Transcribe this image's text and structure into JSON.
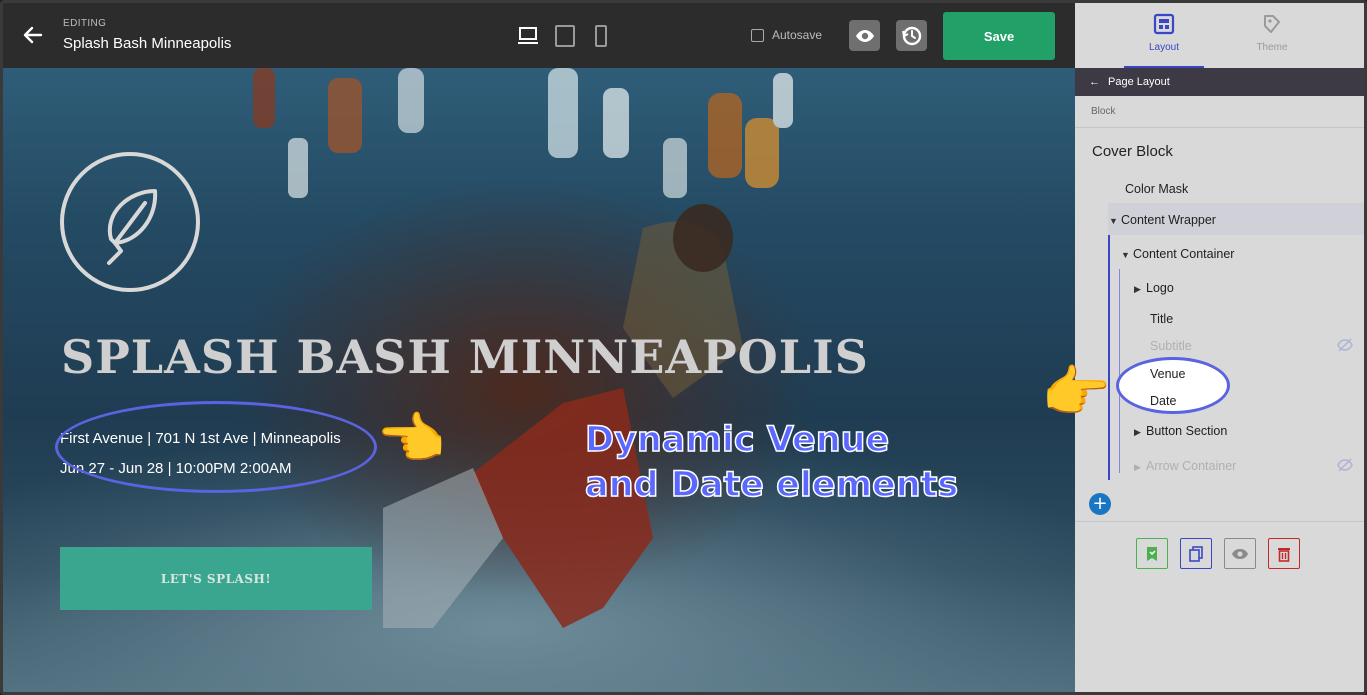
{
  "header": {
    "editing_label": "EDITING",
    "page_name": "Splash Bash Minneapolis",
    "autosave_label": "Autosave",
    "save_label": "Save"
  },
  "hero": {
    "title": "SPLASH BASH MINNEAPOLIS",
    "venue": "First Avenue | 701 N 1st Ave | Minneapolis",
    "date": "Jun 27 - Jun 28  |  10:00PM 2:00AM",
    "cta": "LET'S SPLASH!"
  },
  "annotation": {
    "line1": "Dynamic Venue",
    "line2": "and Date elements",
    "accent": "#5a68ff"
  },
  "panel": {
    "tabs": [
      {
        "label": "Layout",
        "active": true
      },
      {
        "label": "Theme",
        "active": false
      }
    ],
    "breadcrumb": "Page Layout",
    "block_label": "Block",
    "block_name": "Cover Block",
    "tree": {
      "color_mask": "Color Mask",
      "content_wrapper": "Content Wrapper",
      "content_container": "Content Container",
      "logo": "Logo",
      "title": "Title",
      "subtitle": "Subtitle",
      "venue": "Venue",
      "date": "Date",
      "button_section": "Button Section",
      "arrow_container": "Arrow Container"
    }
  },
  "colors": {
    "save": "#21a067",
    "cta": "#3aa690",
    "accent_blue": "#3a47c5"
  }
}
